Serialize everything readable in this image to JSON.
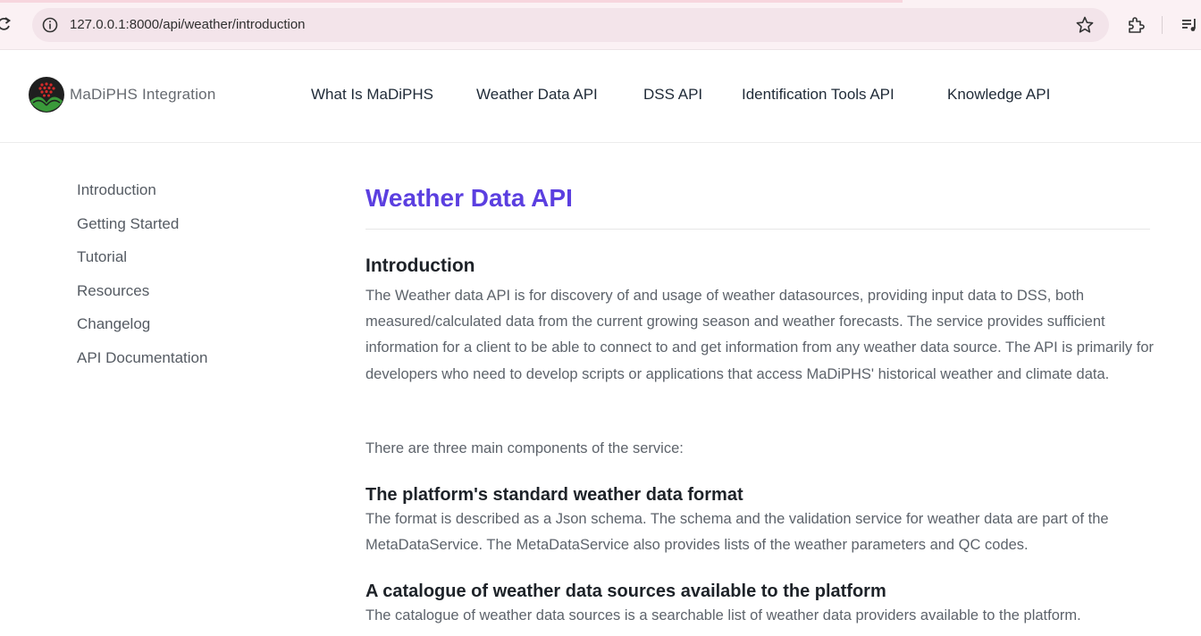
{
  "browser": {
    "url": "127.0.0.1:8000/api/weather/introduction",
    "icons": [
      "reload-icon",
      "site-info-icon",
      "bookmark-star-icon",
      "extensions-icon",
      "media-controls-icon"
    ]
  },
  "header": {
    "brand": "MaDiPHS Integration",
    "nav": [
      "What Is MaDiPHS",
      "Weather Data API",
      "DSS API",
      "Identification Tools API",
      "Knowledge API"
    ]
  },
  "sidebar": {
    "items": [
      "Introduction",
      "Getting Started",
      "Tutorial",
      "Resources",
      "Changelog",
      "API Documentation"
    ]
  },
  "main": {
    "title": "Weather Data API",
    "intro_heading": "Introduction",
    "intro_text": "The Weather data API is for discovery of and usage of weather datasources, providing input data to DSS, both measured/calculated data from the current growing season and weather forecasts. The service provides sufficient information for a client to be able to connect to and get information from any weather data source. The API is primarily for developers who need to develop scripts or applications that access MaDiPHS' historical weather and climate data.",
    "components_intro": "There are three main components of the service:",
    "sections": [
      {
        "heading": "The platform's standard weather data format",
        "text": "The format is described as a Json schema. The schema and the validation service for weather data are part of the MetaDataService. The MetaDataService also provides lists of the weather parameters and QC codes."
      },
      {
        "heading": "A catalogue of weather data sources available to the platform",
        "text": "The catalogue of weather data sources is a searchable list of weather data providers available to the platform."
      }
    ]
  },
  "colors": {
    "accent": "#5b3fe0",
    "body_text": "#5d636b",
    "heading": "#1d2228",
    "nav_text": "#1f2a37"
  }
}
